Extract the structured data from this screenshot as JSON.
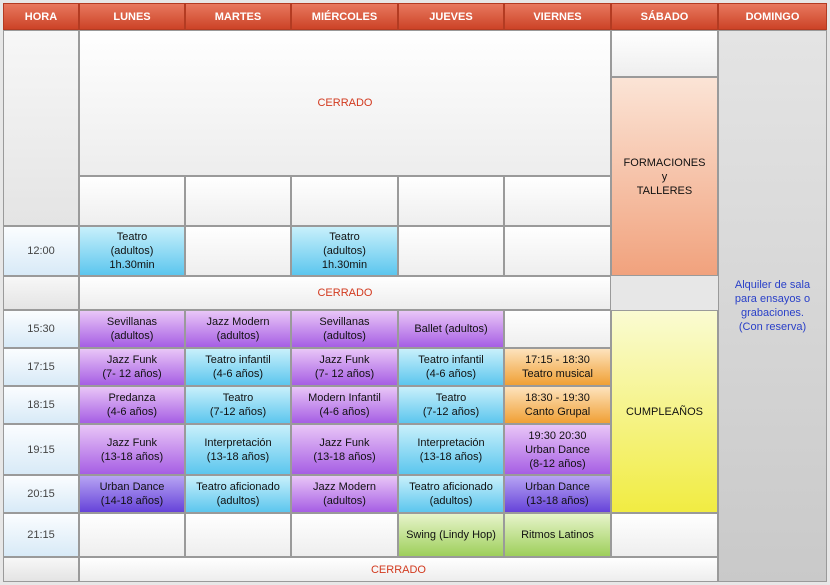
{
  "header": {
    "hora": "HORA",
    "lunes": "LUNES",
    "martes": "MARTES",
    "miercoles": "MIÉRCOLES",
    "jueves": "JUEVES",
    "viernes": "VIERNES",
    "sabado": "SÁBADO",
    "domingo": "DOMINGO"
  },
  "times": {
    "t1200": "12:00",
    "t1530": "15:30",
    "t1715": "17:15",
    "t1815": "18:15",
    "t1915": "19:15",
    "t2015": "20:15",
    "t2115": "21:15"
  },
  "closed": {
    "morning": "CERRADO",
    "midday": "CERRADO",
    "night": "CERRADO"
  },
  "saturday": {
    "formaciones": "FORMACIONES\ny\nTALLERES",
    "cumpleanos": "CUMPLEAÑOS"
  },
  "sunday": {
    "text": "Alquiler de sala\npara ensayos o\ngrabaciones.\n(Con reserva)"
  },
  "classes": {
    "mon_1200": "Teatro\n(adultos)\n1h.30min",
    "wed_1200": "Teatro\n(adultos)\n1h.30min",
    "mon_1530": "Sevillanas\n(adultos)",
    "tue_1530": "Jazz Modern\n(adultos)",
    "wed_1530": "Sevillanas\n(adultos)",
    "thu_1530": "Ballet (adultos)",
    "mon_1715": "Jazz Funk\n(7- 12 años)",
    "tue_1715": "Teatro infantil\n(4-6 años)",
    "wed_1715": "Jazz Funk\n(7- 12 años)",
    "thu_1715": "Teatro infantil\n(4-6 años)",
    "fri_1715": "17:15 - 18:30\nTeatro musical",
    "mon_1815": "Predanza\n(4-6 años)",
    "tue_1815": "Teatro\n(7-12 años)",
    "wed_1815": "Modern Infantil\n(4-6 años)",
    "thu_1815": "Teatro\n(7-12 años)",
    "fri_1815": "18:30 - 19:30\nCanto Grupal",
    "mon_1915": "Jazz Funk\n(13-18 años)",
    "tue_1915": "Interpretación\n(13-18 años)",
    "wed_1915": "Jazz Funk\n(13-18 años)",
    "thu_1915": "Interpretación\n(13-18 años)",
    "fri_1915": "19:30 20:30\nUrban Dance\n(8-12 años)",
    "mon_2015": "Urban Dance\n(14-18 años)",
    "tue_2015": "Teatro aficionado\n(adultos)",
    "wed_2015": "Jazz Modern\n(adultos)",
    "thu_2015": "Teatro aficionado\n(adultos)",
    "fri_2015": "Urban Dance\n(13-18 años)",
    "thu_2115": "Swing (Lindy Hop)",
    "fri_2115": "Ritmos Latinos"
  },
  "colors": {
    "header": "#d9533a",
    "closed_text": "#d23a1f",
    "sunday_text": "#2a40c8",
    "adult_theatre": "#5cc6ee",
    "dance": "#a65ee4",
    "urban": "#6643d9",
    "friday_specials": "#f0a035",
    "social_dance": "#9ecf5b",
    "formaciones": "#f1a27d",
    "cumpleanos": "#f1ec42"
  }
}
